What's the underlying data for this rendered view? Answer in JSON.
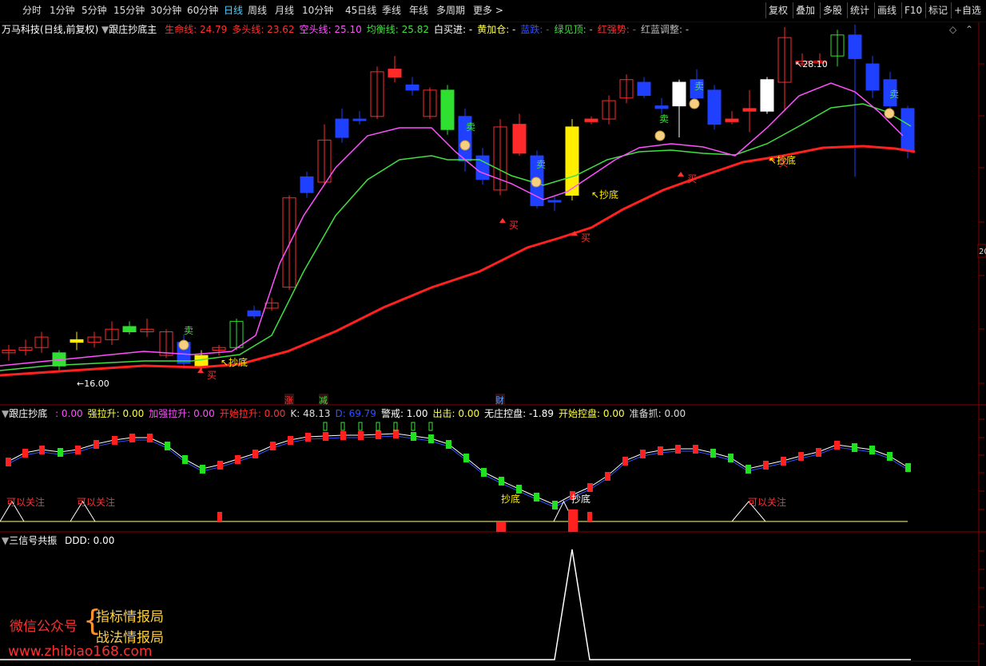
{
  "toolbar": {
    "periods": [
      "分时",
      "1分钟",
      "5分钟",
      "15分钟",
      "30分钟",
      "60分钟",
      "日线",
      "周线",
      "月线",
      "10分钟",
      "45日线",
      "季线",
      "年线",
      "多周期",
      "更多 >"
    ],
    "active_index": 6,
    "right_buttons": [
      "复权",
      "叠加",
      "多股",
      "统计",
      "画线",
      "F10",
      "标记",
      "+自选"
    ]
  },
  "main": {
    "stock": "万马科技",
    "period_label": "(日线,前复权)",
    "indicator": "跟庄抄底主",
    "fields": [
      {
        "label": "生命线",
        "value": "24.79",
        "color": "#ff3030"
      },
      {
        "label": "多头线",
        "value": "23.62",
        "color": "#ff3030"
      },
      {
        "label": "空头线",
        "value": "25.10",
        "color": "#ff50ff"
      },
      {
        "label": "均衡线",
        "value": "25.82",
        "color": "#40e040"
      },
      {
        "label": "白买进",
        "value": "-",
        "color": "#ffffff"
      },
      {
        "label": "黄加仓",
        "value": "-",
        "color": "#ffff40"
      },
      {
        "label": "蓝跌",
        "value": "-",
        "color": "#3050ff"
      },
      {
        "label": "绿见顶",
        "value": "-",
        "color": "#40e040"
      },
      {
        "label": "红强势",
        "value": "-",
        "color": "#ff3030"
      },
      {
        "label": "红蓝调整",
        "value": "-",
        "color": "#bbbbbb"
      }
    ],
    "high_label": "28.10",
    "low_label": "16.00",
    "right_price": "20",
    "annotations": {
      "sell": "卖",
      "buy": "买",
      "chaodi": "抄底"
    }
  },
  "mid_badges": [
    "涨",
    "减",
    "财"
  ],
  "sub1": {
    "name": "跟庄抄底",
    "fields": [
      {
        "label": "",
        "value": "0.00",
        "color": "#ff50ff"
      },
      {
        "label": "强拉升",
        "value": "0.00",
        "color": "#ffff40"
      },
      {
        "label": "加强拉升",
        "value": "0.00",
        "color": "#ff50ff"
      },
      {
        "label": "开始拉升",
        "value": "0.00",
        "color": "#ff3030"
      },
      {
        "label": "K",
        "value": "48.13",
        "color": "#dddddd"
      },
      {
        "label": "D",
        "value": "69.79",
        "color": "#3050ff"
      },
      {
        "label": "警戒",
        "value": "1.00",
        "color": "#ffffff"
      },
      {
        "label": "出击",
        "value": "0.00",
        "color": "#ffff40"
      },
      {
        "label": "无庄控盘",
        "value": "-1.89",
        "color": "#ffffff"
      },
      {
        "label": "开始控盘",
        "value": "0.00",
        "color": "#ffff40"
      },
      {
        "label": "准备抓",
        "value": "0.00",
        "color": "#dddddd"
      }
    ],
    "tags": {
      "watch": "可以关注",
      "chaodi": "抄底"
    }
  },
  "sub2": {
    "name": "三信号共振",
    "fields": [
      {
        "label": "DDD",
        "value": "0.00",
        "color": "#ffffff"
      }
    ]
  },
  "watermark": {
    "left": "微信公众号",
    "line1": "指标情报局",
    "line2": "战法情报局",
    "url": "www.zhibiao168.com"
  },
  "colors": {
    "up": "#ff2a2a",
    "down": "#2040ff",
    "life": "#ff2020",
    "bull": "#ff50ff",
    "bear": "#40e040"
  }
}
